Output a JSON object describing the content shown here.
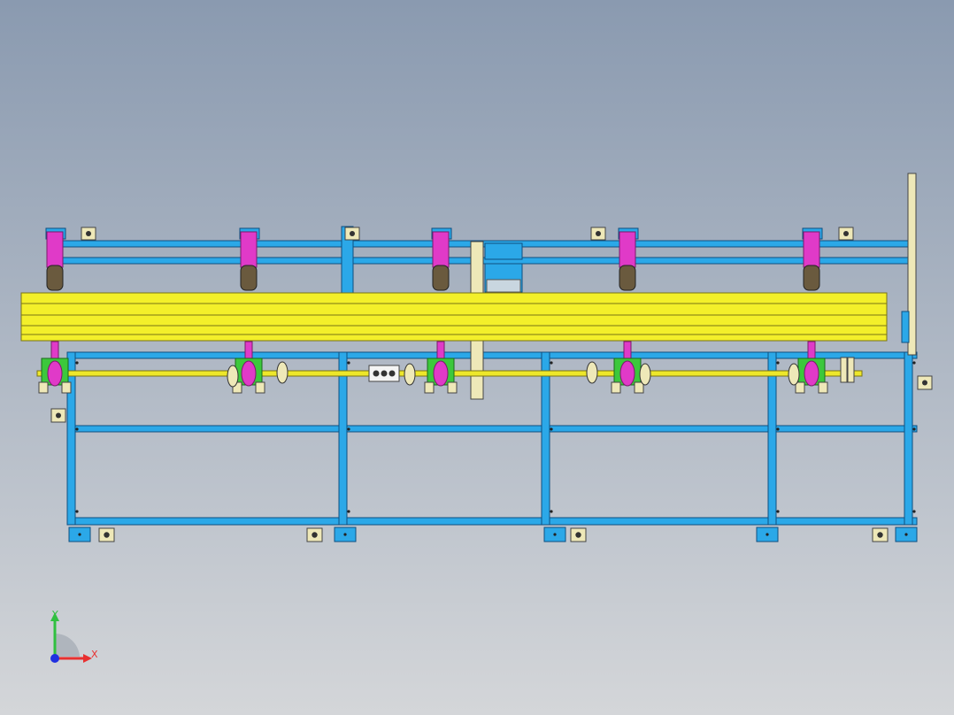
{
  "viewport": {
    "background_top": "#8A9AB0",
    "background_bottom": "#D4D6D9"
  },
  "model": {
    "frame_color": "#2BA8E8",
    "frame_edge_color": "#0F4F80",
    "beam_color": "#F3EF2A",
    "beam_edge_color": "#7A7414",
    "roller_color": "#E03AC8",
    "motor_color": "#6A5A3E",
    "bracket_green": "#3CC83C",
    "bracket_cream": "#EEE8B8",
    "shaft_color": "#EDE72A"
  },
  "triad": {
    "x_label": "X",
    "y_label": "Y",
    "x_color": "#E83030",
    "y_color": "#30C040",
    "z_color": "#2030E0"
  }
}
